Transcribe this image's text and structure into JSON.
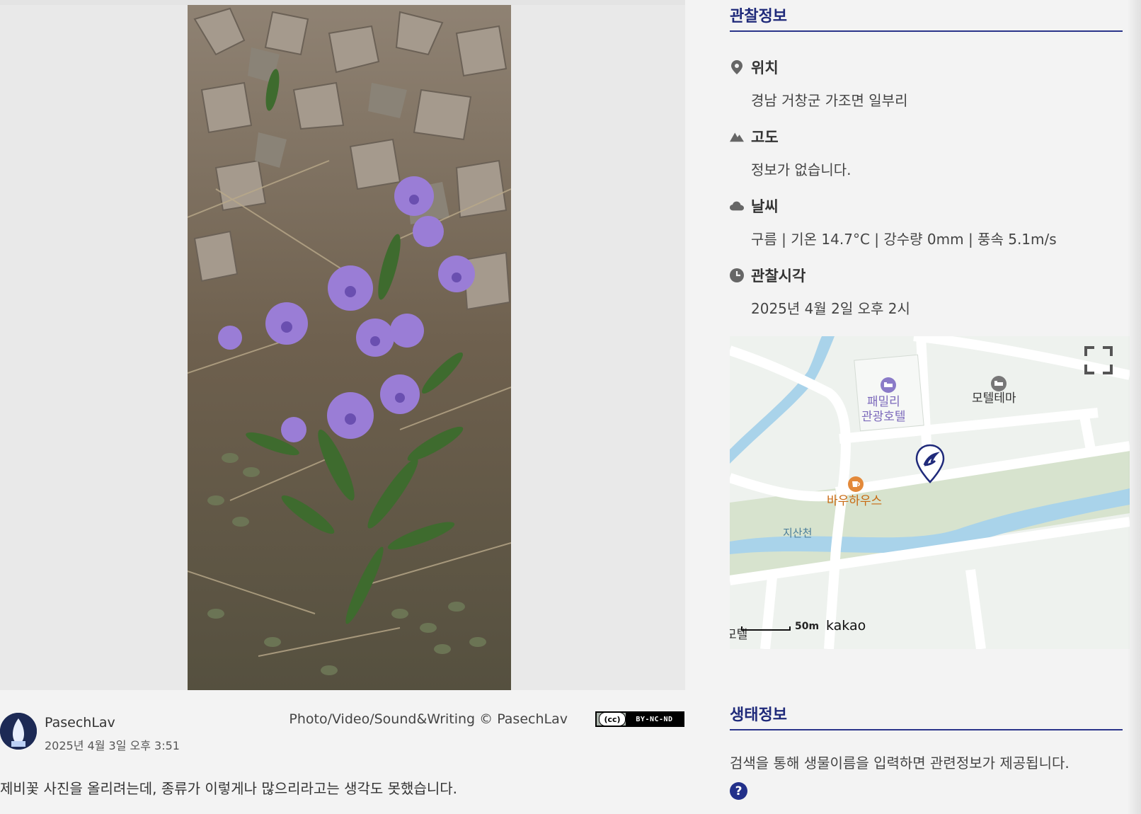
{
  "observation": {
    "title": "관찰정보",
    "location": {
      "label": "위치",
      "value": "경남 거창군 가조면 일부리",
      "icon": "map-pin-icon"
    },
    "altitude": {
      "label": "고도",
      "value": "정보가 없습니다.",
      "icon": "mountain-icon"
    },
    "weather": {
      "label": "날씨",
      "value": "구름 | 기온 14.7°C | 강수량 0mm | 풍속 5.1m/s",
      "icon": "cloud-icon"
    },
    "time": {
      "label": "관찰시각",
      "value": "2025년 4월 2일 오후 2시",
      "icon": "clock-icon"
    }
  },
  "map": {
    "places": {
      "hotel": "패밀리\n관광호텔",
      "motel": "모텔테마",
      "cafe": "바우하우스",
      "stream": "지산천",
      "motel_partial": "모텔"
    },
    "scale_label": "50m",
    "provider": "kakao",
    "accent_color": "#1f2a7a"
  },
  "post": {
    "author": "PasechLav",
    "date": "2025년 4월 3일 오후 3:51",
    "credit": "Photo/Video/Sound&Writing © PasechLav",
    "license": "BY-NC-ND",
    "cc_mark": "(cc)",
    "comment": "제비꽃 사진을 올리려는데, 종류가 이렇게나 많으리라고는 생각도 못했습니다."
  },
  "ecology": {
    "title": "생태정보",
    "text": "검색을 통해 생물이름을 입력하면 관련정보가 제공됩니다.",
    "help_symbol": "?"
  }
}
